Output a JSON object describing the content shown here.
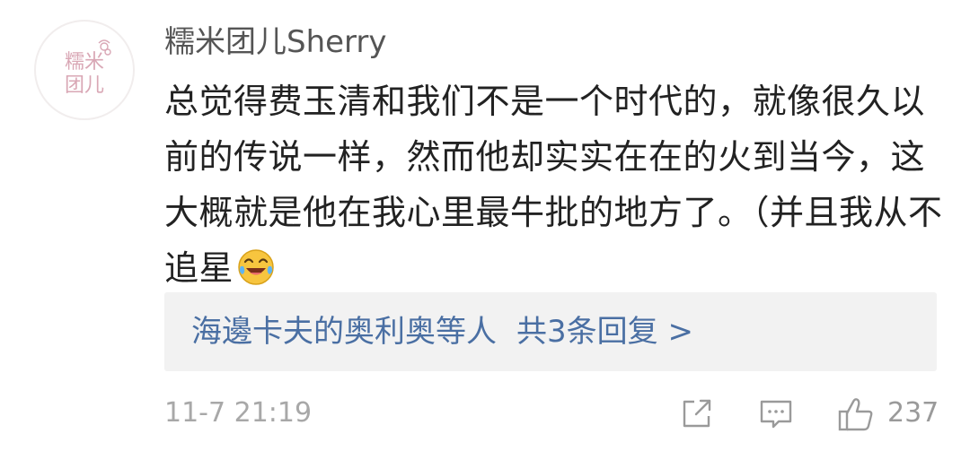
{
  "comment": {
    "avatar_logo_text": "糯米团儿",
    "username": "糯米团儿Sherry",
    "text": "总觉得费玉清和我们不是一个时代的，就像很久以前的传说一样，然而他却实实在在的火到当今，这大概就是他在我心里最牛批的地方了。（并且我从不追星",
    "emoji_icon": "laughing-crying-emoji",
    "replies": {
      "names": "海邊卡夫的奥利奥等人",
      "count_label": "共3条回复 >"
    },
    "timestamp": "11-7 21:19",
    "actions": {
      "share_icon": "share-icon",
      "comment_icon": "comment-icon",
      "like_icon": "thumbs-up-icon",
      "like_count": "237"
    },
    "colors": {
      "link_blue": "#4a6fa3",
      "reply_box_bg": "#f2f2f2",
      "meta_gray": "#a8a8a8",
      "avatar_pink": "#d9a7b5"
    }
  }
}
